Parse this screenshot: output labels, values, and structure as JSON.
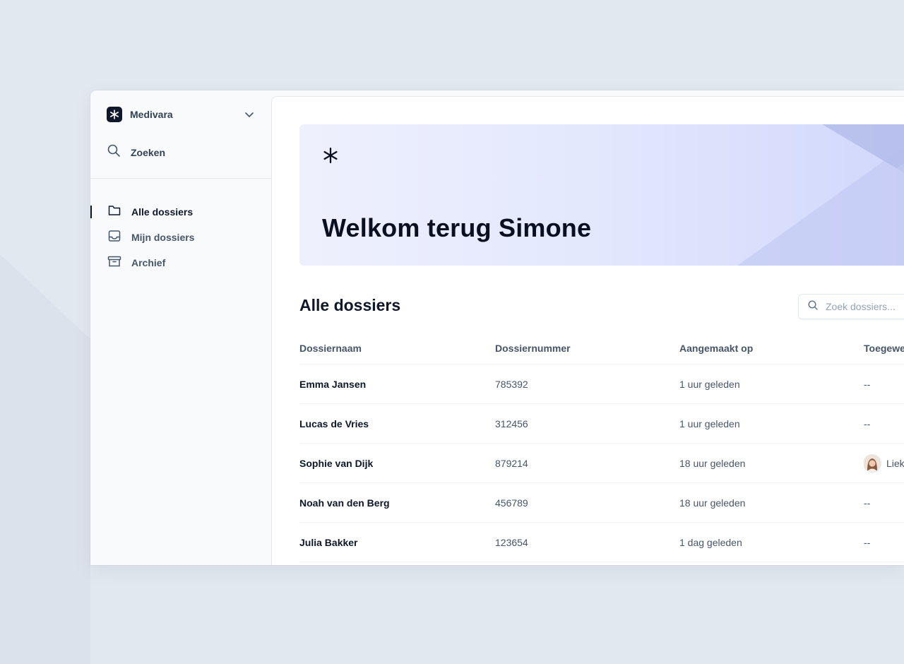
{
  "sidebar": {
    "org_name": "Medivara",
    "search_label": "Zoeken",
    "nav": [
      {
        "label": "Alle dossiers",
        "icon": "folder-icon",
        "active": true
      },
      {
        "label": "Mijn dossiers",
        "icon": "inbox-icon",
        "active": false
      },
      {
        "label": "Archief",
        "icon": "archive-icon",
        "active": false
      }
    ]
  },
  "hero": {
    "title": "Welkom terug Simone"
  },
  "section": {
    "title": "Alle dossiers",
    "search_placeholder": "Zoek dossiers..."
  },
  "table": {
    "headers": [
      "Dossiernaam",
      "Dossiernummer",
      "Aangemaakt op",
      "Toegewe"
    ],
    "rows": [
      {
        "name": "Emma Jansen",
        "number": "785392",
        "created": "1 uur geleden",
        "assigned": "--"
      },
      {
        "name": "Lucas de Vries",
        "number": "312456",
        "created": "1 uur geleden",
        "assigned": "--"
      },
      {
        "name": "Sophie van Dijk",
        "number": "879214",
        "created": "18 uur geleden",
        "assigned": "Liek"
      },
      {
        "name": "Noah van den Berg",
        "number": "456789",
        "created": "18 uur geleden",
        "assigned": "--"
      },
      {
        "name": "Julia Bakker",
        "number": "123654",
        "created": "1 dag geleden",
        "assigned": "--"
      }
    ]
  },
  "colors": {
    "background": "#e2e8f0",
    "sidebar": "#f8fafc",
    "text_primary": "#0f172a",
    "text_secondary": "#475569",
    "hero_gradient_start": "#eef0fd",
    "hero_gradient_end": "#cfd6fb"
  }
}
